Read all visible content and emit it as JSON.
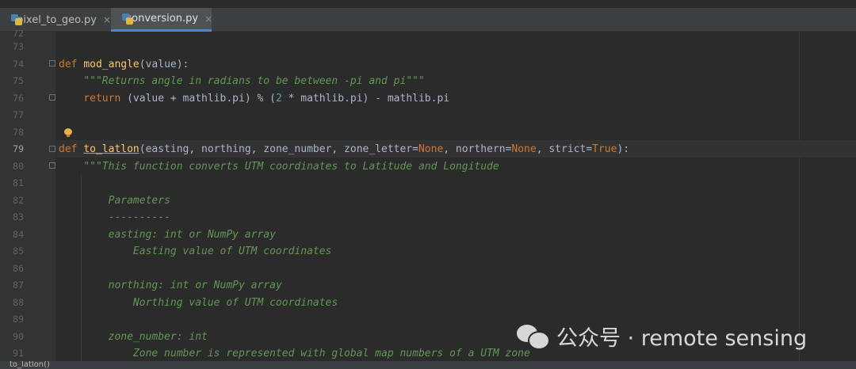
{
  "tabs": [
    {
      "label": "pixel_to_geo.py",
      "close": "×",
      "active": false
    },
    {
      "label": "conversion.py",
      "close": "×",
      "active": true
    }
  ],
  "line_top_partial": "72",
  "lines": [
    {
      "n": "73",
      "html": ""
    },
    {
      "n": "74",
      "html": "<span class=\"kw\">def</span> <span class=\"fn\">mod_angle</span>(value):"
    },
    {
      "n": "75",
      "html": "    <span class=\"doc\">\"\"\"Returns angle in radians to be between -pi and pi\"\"\"</span>"
    },
    {
      "n": "76",
      "html": "    <span class=\"kw\">return</span> (value + mathlib.pi) % (<span class=\"num\">2</span> * mathlib.pi) - mathlib.pi"
    },
    {
      "n": "77",
      "html": ""
    },
    {
      "n": "78",
      "html": ""
    },
    {
      "n": "79",
      "html": "<span class=\"kw\">def</span> <span class=\"fn\" style=\"text-decoration:underline;text-decoration-color:#a0a0a0\">to_latlon</span>(easting, northing, zone_number, zone_letter=<span class=\"kw\">None</span>, northern=<span class=\"kw\">None</span>, strict=<span class=\"kw\">True</span>):"
    },
    {
      "n": "80",
      "html": "    <span class=\"doc\">\"\"\"This function converts UTM coordinates to Latitude and Longitude</span>"
    },
    {
      "n": "81",
      "html": ""
    },
    {
      "n": "82",
      "html": "        <span class=\"doc\">Parameters</span>"
    },
    {
      "n": "83",
      "html": "        <span class=\"doc\">----------</span>"
    },
    {
      "n": "84",
      "html": "        <span class=\"doc\">easting: int or NumPy array</span>"
    },
    {
      "n": "85",
      "html": "            <span class=\"doc\">Easting value of UTM coordinates</span>"
    },
    {
      "n": "86",
      "html": ""
    },
    {
      "n": "87",
      "html": "        <span class=\"doc\">northing: int or NumPy array</span>"
    },
    {
      "n": "88",
      "html": "            <span class=\"doc\">Northing value of UTM coordinates</span>"
    },
    {
      "n": "89",
      "html": ""
    },
    {
      "n": "90",
      "html": "        <span class=\"doc\">zone_number: int</span>"
    },
    {
      "n": "91",
      "html": "            <span class=\"doc\">Zone number is represented with global map numbers of a UTM zone</span>"
    }
  ],
  "current_line": "79",
  "status": {
    "breadcrumb": "to_latlon()"
  },
  "watermark": {
    "text": "公众号 · remote sensing"
  }
}
